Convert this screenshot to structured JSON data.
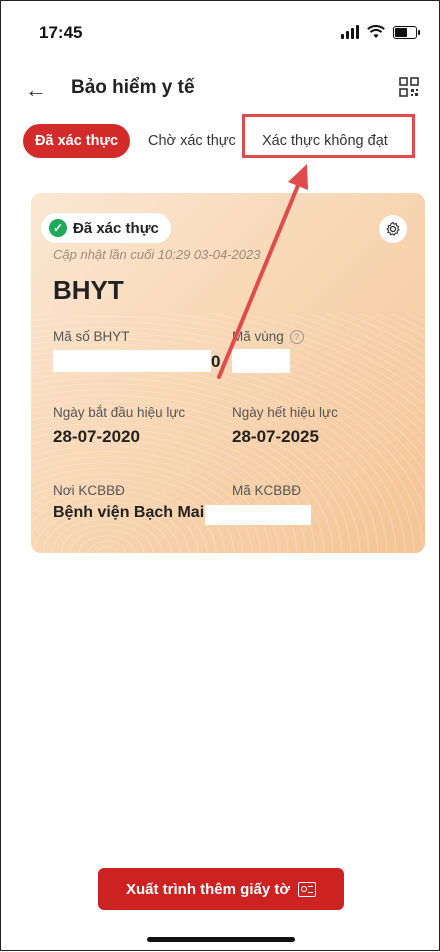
{
  "status_bar": {
    "time": "17:45"
  },
  "header": {
    "title": "Bảo hiểm y tế"
  },
  "tabs": [
    {
      "label": "Đã xác thực"
    },
    {
      "label": "Chờ xác thực"
    },
    {
      "label": "Xác thực không đạt"
    }
  ],
  "card": {
    "badge": "Đã xác thực",
    "updated": "Cập nhật lần cuối 10:29 03-04-2023",
    "title": "BHYT",
    "fields": {
      "code_label": "Mã số BHYT",
      "code_value_tail": "0",
      "region_label": "Mã vùng",
      "start_label": "Ngày bắt đầu hiệu lực",
      "start_value": "28-07-2020",
      "end_label": "Ngày hết hiệu lực",
      "end_value": "28-07-2025",
      "place_label": "Nơi KCBBĐ",
      "place_value": "Bệnh viện Bạch Mai",
      "place_code_label": "Mã KCBBĐ"
    }
  },
  "bottom_button": {
    "label": "Xuất trình thêm giấy tờ"
  },
  "colors": {
    "accent": "#d32a2a",
    "annotation": "#e24b4b"
  }
}
